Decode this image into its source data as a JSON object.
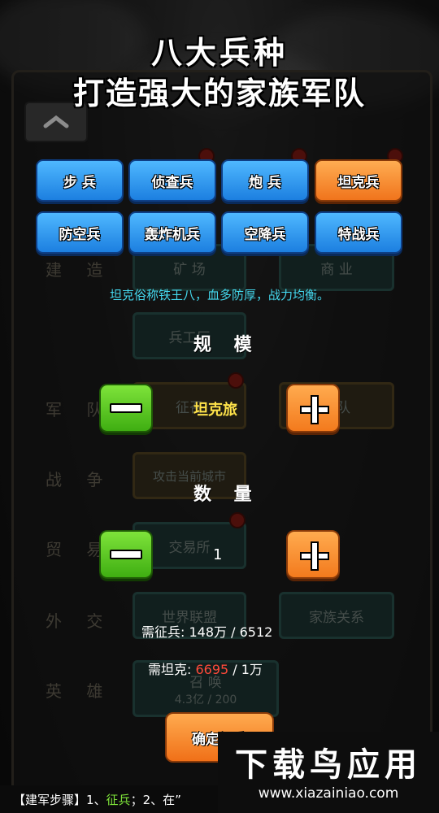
{
  "banner": {
    "line1": "八大兵种",
    "line2": "打造强大的家族军队"
  },
  "unit_types": [
    {
      "label": "步 兵",
      "selected": false
    },
    {
      "label": "侦查兵",
      "selected": false
    },
    {
      "label": "炮 兵",
      "selected": false
    },
    {
      "label": "坦克兵",
      "selected": true
    },
    {
      "label": "防空兵",
      "selected": false
    },
    {
      "label": "轰炸机兵",
      "selected": false
    },
    {
      "label": "空降兵",
      "selected": false
    },
    {
      "label": "特战兵",
      "selected": false
    }
  ],
  "description": "坦克俗称铁王八，血多防厚，战力均衡。",
  "scale": {
    "title": "规 模",
    "value": "坦克旅"
  },
  "quantity": {
    "title": "数 量",
    "value": "1"
  },
  "requirements": {
    "troops_label": "需征兵:",
    "troops_value": "148万 / 6512",
    "tanks_label": "需坦克:",
    "tanks_have": "6695",
    "tanks_need": " / 1万"
  },
  "confirm_label": "确定征兵",
  "background": {
    "rows": [
      "建 造",
      "军 队",
      "战 争",
      "贸 易",
      "外 交",
      "英 雄"
    ],
    "buttons": [
      "矿 场",
      "商 业",
      "兵工厂",
      "征召",
      "军队",
      "攻击当前城市",
      "交易所",
      "世界联盟",
      "家族关系",
      "召 唤",
      "4.3亿 / 200"
    ]
  },
  "footer": {
    "prefix": "【建军步骤】1、",
    "step1": "征兵",
    "rest": "；2、在”"
  },
  "watermark": {
    "title": "下载鸟应用",
    "url": "www.xiazainiao.com"
  },
  "colors": {
    "selected": "#f37a1d",
    "unselected": "#1c7fe0",
    "description": "#44d8ee",
    "shortfall": "#ff4a3a",
    "step": "#7ee33a"
  }
}
